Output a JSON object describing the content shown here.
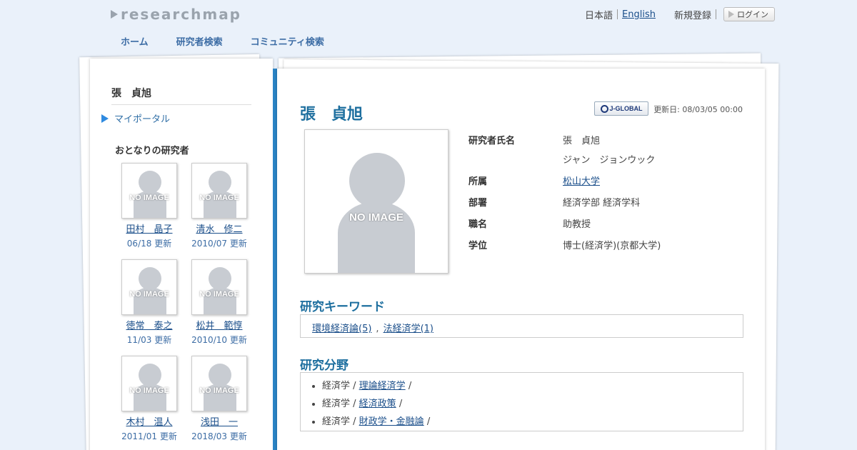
{
  "header": {
    "logo": "researchmap",
    "lang_ja": "日本語",
    "lang_en": "English",
    "register": "新規登録",
    "login": "ログイン"
  },
  "nav": [
    "ホーム",
    "研究者検索",
    "コミュニティ検索"
  ],
  "sidebar": {
    "name": "張　貞旭",
    "myportal": "マイポータル",
    "neighbors_title": "おとなりの研究者",
    "no_image": "NO IMAGE",
    "neighbors": [
      {
        "name": "田村　晶子",
        "date": "06/18 更新"
      },
      {
        "name": "清水　修二",
        "date": "2010/07 更新"
      },
      {
        "name": "徳常　泰之",
        "date": "11/03 更新"
      },
      {
        "name": "松井　範惇",
        "date": "2010/10 更新"
      },
      {
        "name": "木村　温人",
        "date": "2011/01 更新"
      },
      {
        "name": "浅田　一",
        "date": "2018/03 更新"
      }
    ]
  },
  "profile": {
    "name": "張　貞旭",
    "jglobal": "J-GLOBAL",
    "updated": "更新日: 08/03/05 00:00",
    "no_image": "NO IMAGE",
    "fields": {
      "name_label": "研究者氏名",
      "name_value": "張　貞旭",
      "name_kana": "ジャン　ジョンウック",
      "affiliation_label": "所属",
      "affiliation_value": "松山大学",
      "department_label": "部署",
      "department_value": "経済学部 経済学科",
      "position_label": "職名",
      "position_value": "助教授",
      "degree_label": "学位",
      "degree_value": "博士(経済学)(京都大学)"
    }
  },
  "keywords": {
    "title": "研究キーワード",
    "items": [
      "環境経済論(5)",
      "法経済学(1)"
    ],
    "separator": ","
  },
  "research_fields": {
    "title": "研究分野",
    "items": [
      {
        "category": "経済学 /",
        "link": "理論経済学",
        "suffix": "/"
      },
      {
        "category": "経済学 /",
        "link": "経済政策",
        "suffix": "/"
      },
      {
        "category": "経済学 /",
        "link": "財政学・金融論",
        "suffix": "/"
      }
    ]
  },
  "colors": {
    "background": "#eaf1fa",
    "accent_blue": "#2a84c6",
    "title_teal": "#1e6f9f",
    "link": "#1a4e8a"
  }
}
